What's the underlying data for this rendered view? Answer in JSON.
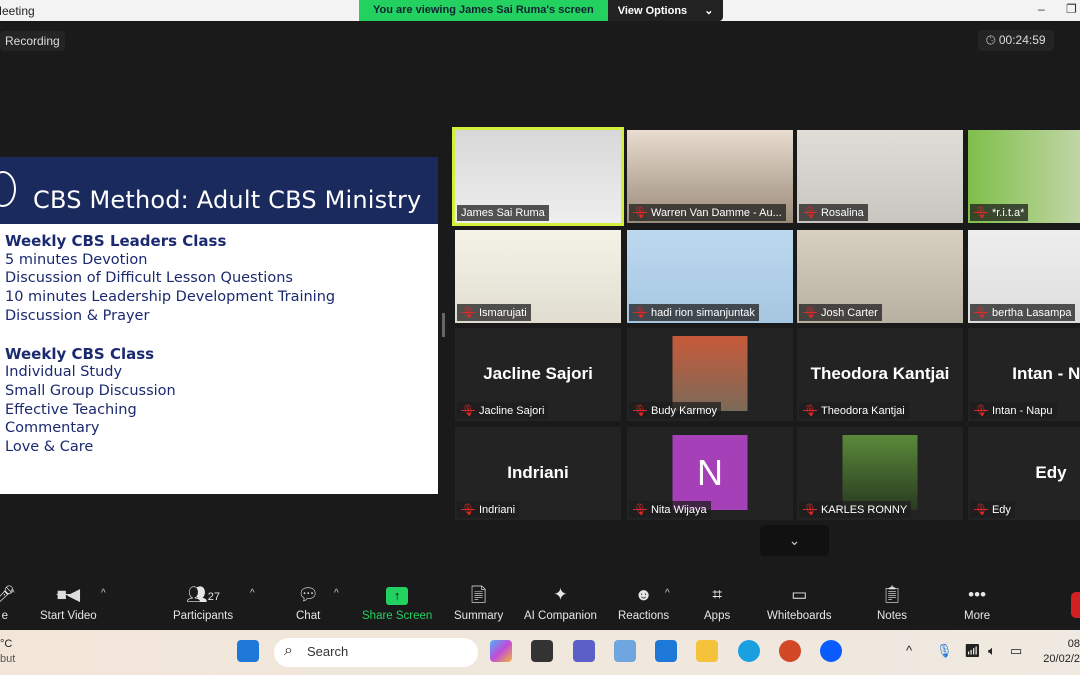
{
  "window": {
    "title": "Meeting"
  },
  "banner": {
    "viewing": "You are viewing James Sai Ruma's screen",
    "view_options": "View Options"
  },
  "recording": "Recording",
  "timer": "00:24:59",
  "slide": {
    "title": "CBS Method: Adult  CBS  Ministry",
    "section1": {
      "heading": "Weekly CBS Leaders Class",
      "items": [
        "5 minutes Devotion",
        "Discussion of Difficult Lesson Questions",
        "10 minutes Leadership Development Training",
        "Discussion & Prayer"
      ]
    },
    "section2": {
      "heading": "Weekly CBS Class",
      "items": [
        "Individual Study",
        "Small Group Discussion",
        "Effective Teaching",
        "Commentary",
        "Love & Care"
      ]
    }
  },
  "participants": [
    {
      "name": "James Sai Ruma",
      "muted": false,
      "active": true
    },
    {
      "name": "Warren Van Damme - Au...",
      "muted": true
    },
    {
      "name": "Rosalina",
      "muted": true
    },
    {
      "name": "*r.i.t.a*",
      "muted": true
    },
    {
      "name": "Ismarujati",
      "muted": true
    },
    {
      "name": "hadi rion simanjuntak",
      "muted": true
    },
    {
      "name": "Josh Carter",
      "muted": true
    },
    {
      "name": "bertha Lasampa",
      "muted": true
    },
    {
      "name": "Jacline Sajori",
      "muted": true,
      "display": "Jacline Sajori"
    },
    {
      "name": "Budy Karmoy",
      "muted": true
    },
    {
      "name": "Theodora Kantjai",
      "muted": true,
      "display": "Theodora Kantjai"
    },
    {
      "name": "Intan - Napu",
      "muted": true,
      "display": "Intan - Na"
    },
    {
      "name": "Indriani",
      "muted": true,
      "display": "Indriani"
    },
    {
      "name": "Nita Wijaya",
      "muted": true,
      "avatar_letter": "N",
      "avatar_color": "#a640b8"
    },
    {
      "name": "KARLES RONNY",
      "muted": true
    },
    {
      "name": "Edy",
      "muted": true,
      "display": "Edy"
    }
  ],
  "toolbar": {
    "start_video": "Start Video",
    "participants": "Participants",
    "participant_count": "27",
    "chat": "Chat",
    "share_screen": "Share Screen",
    "summary": "Summary",
    "ai_companion": "AI Companion",
    "reactions": "Reactions",
    "apps": "Apps",
    "whiteboards": "Whiteboards",
    "notes": "Notes",
    "more": "More",
    "share_color": "#23d160"
  },
  "taskbar": {
    "search_placeholder": "Search",
    "weather_temp": "°C",
    "weather_desc": "but",
    "time": "08",
    "date": "20/02/2"
  }
}
